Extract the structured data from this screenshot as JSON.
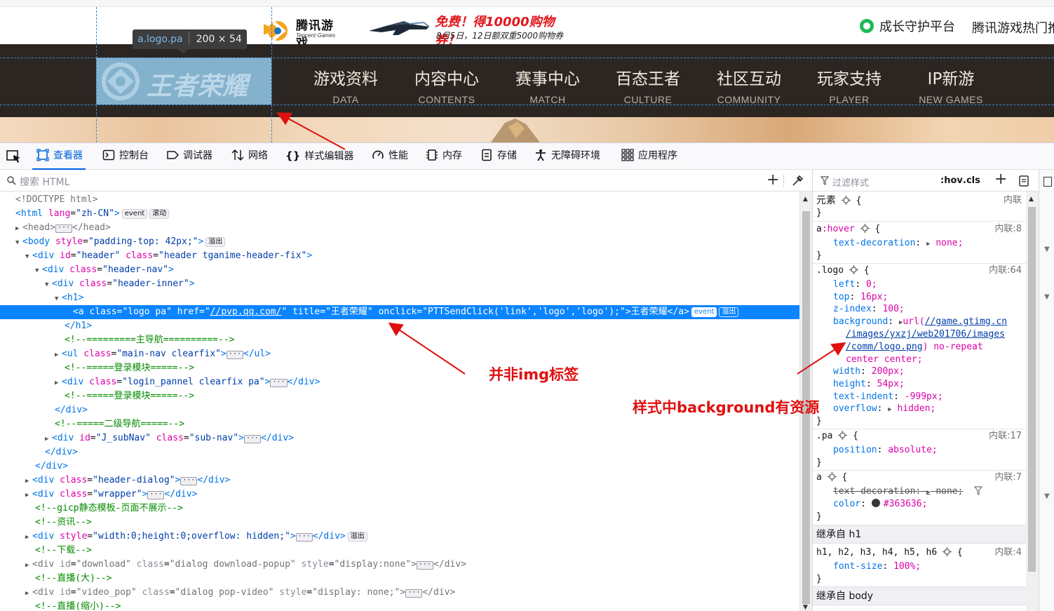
{
  "site": {
    "tencent_games_cn": "腾讯游戏",
    "tencent_games_en": "Tencent Games",
    "promo_line1": "免费！得10000购物券！",
    "promo_line2": "8月5日，12日额双重5000购物券",
    "growth_platform": "成长守护平台",
    "hot_games": "腾讯游戏热门推",
    "logo_text": "王者荣耀",
    "nav": [
      {
        "cn": "游戏资料",
        "en": "DATA"
      },
      {
        "cn": "内容中心",
        "en": "CONTENTS"
      },
      {
        "cn": "赛事中心",
        "en": "MATCH"
      },
      {
        "cn": "百态王者",
        "en": "CULTURE"
      },
      {
        "cn": "社区互动",
        "en": "COMMUNITY"
      },
      {
        "cn": "玩家支持",
        "en": "PLAYER"
      },
      {
        "cn": "IP新游",
        "en": "NEW GAMES"
      }
    ]
  },
  "inspector_tooltip": {
    "selector": "a.logo.pa",
    "dimensions": "200 × 54"
  },
  "devtools": {
    "tabs": [
      {
        "label": "查看器",
        "icon": "inspector-icon",
        "active": true
      },
      {
        "label": "控制台",
        "icon": "console-icon"
      },
      {
        "label": "调试器",
        "icon": "debugger-icon"
      },
      {
        "label": "网络",
        "icon": "network-icon"
      },
      {
        "label": "样式编辑器",
        "icon": "style-editor-icon"
      },
      {
        "label": "性能",
        "icon": "performance-icon"
      },
      {
        "label": "内存",
        "icon": "memory-icon"
      },
      {
        "label": "存储",
        "icon": "storage-icon"
      },
      {
        "label": "无障碍环境",
        "icon": "accessibility-icon"
      },
      {
        "label": "应用程序",
        "icon": "application-icon"
      }
    ],
    "search_placeholder": "搜索 HTML",
    "filter_placeholder": "过滤样式",
    "hov": ":hov",
    "cls": ".cls",
    "badges": {
      "event": "event",
      "scroll": "滚动",
      "overflow": "溢出"
    },
    "markup": {
      "doctype": "<!DOCTYPE html>",
      "html_lang": "zh-CN",
      "body_style": "padding-top: 42px;",
      "header_id": "header",
      "header_class": "header tganime-header-fix",
      "header_nav_class": "header-nav",
      "header_inner_class": "header-inner",
      "a_class": "logo pa",
      "a_href": "//pvp.qq.com/",
      "a_title": "王者荣耀",
      "a_onclick": "PTTSendClick('link','logo','logo');",
      "a_text": "王者荣耀",
      "comment_main_nav": "<!--=========主导航==========-->",
      "ul_class": "main-nav clearfix",
      "comment_login1": "<!--=====登录模块=====-->",
      "div_login_class": "login_pannel clearfix pa",
      "comment_login2": "<!--=====登录模块=====-->",
      "comment_subnav": "<!--=====二级导航=====-->",
      "subnav_id": "J_subNav",
      "subnav_class": "sub-nav",
      "header_dialog_class": "header-dialog",
      "wrapper_class": "wrapper",
      "comment_gicp": "<!--gicp静态模板-页面不展示-->",
      "comment_news": "<!--资讯-->",
      "hidden_style": "width:0;height:0;overflow: hidden;",
      "comment_download": "<!--下载-->",
      "download_id": "download",
      "download_class": "dialog download-popup",
      "download_style": "display:none",
      "comment_live_big": "<!--直播(大)-->",
      "video_id": "video_pop",
      "video_class": "dialog pop-video",
      "video_style": "display: none;",
      "comment_live_small": "<!--直播(缩小)-->"
    },
    "rules": {
      "element_label": "元素",
      "inline": "内联",
      "hover_selector": "a",
      "hover_pseudo": ":hover",
      "hover_src": "内联:8",
      "logo_selector": ".logo",
      "logo_src": "内联:64",
      "logo_props": [
        {
          "p": "left",
          "v": "0;"
        },
        {
          "p": "top",
          "v": "16px;"
        },
        {
          "p": "z-index",
          "v": "100;"
        }
      ],
      "bg_prop": "background",
      "bg_url_1": "//game.gtimg.cn",
      "bg_url_2": "/images/yxzj/web201706/images",
      "bg_url_3": "/comm/logo.png",
      "bg_rest_1": ") no-repeat",
      "bg_rest_2": "center center;",
      "logo_props2": [
        {
          "p": "width",
          "v": "200px;"
        },
        {
          "p": "height",
          "v": "54px;"
        },
        {
          "p": "text-indent",
          "v": "-999px;"
        }
      ],
      "overflow_prop": "overflow",
      "overflow_val": "hidden;",
      "pa_selector": ".pa",
      "pa_src": "内联:17",
      "pa_prop": "position",
      "pa_val": "absolute;",
      "a_selector": "a",
      "a_src": "内联:7",
      "td_prop": "text-decoration",
      "td_val": "none;",
      "color_prop": "color",
      "color_val": "#363636;",
      "inherit_h1": "继承自 h1",
      "h_selector": "h1, h2, h3, h4, h5, h6",
      "h_src": "内联:4",
      "fs_prop": "font-size",
      "fs_val": "100%;",
      "inherit_body": "继承自 body"
    }
  },
  "annotations": {
    "not_img": "并非img标签",
    "bg_resource": "样式中background有资源"
  },
  "colors": {
    "accent": "#0a84ff",
    "annotation": "#e01010",
    "nav_bg": "#2c2623",
    "logo_hl": "#9ab9c6"
  }
}
